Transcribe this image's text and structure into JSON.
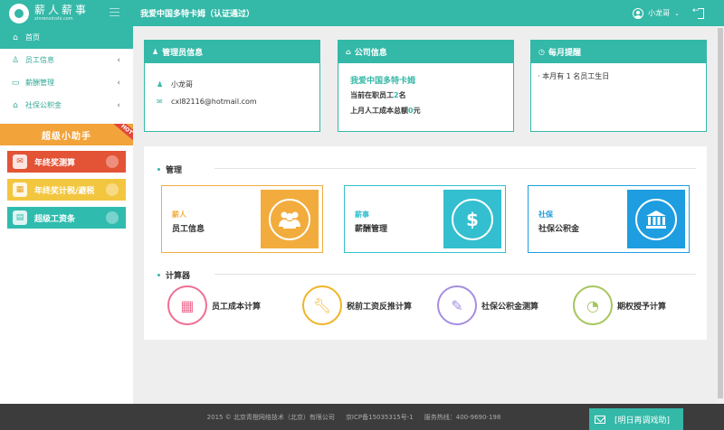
{
  "app": {
    "logo_cn": "薪人薪事",
    "logo_en": "xinrenxinshi.com",
    "company_title": "我爱中国多特卡姆（认证通过）",
    "user_name": "小龙哥",
    "user_caret": "⌄"
  },
  "sidebar": {
    "items": [
      {
        "label": "首页",
        "icon": "home-icon"
      },
      {
        "label": "员工信息",
        "icon": "person-icon",
        "chevron": "‹"
      },
      {
        "label": "薪酬管理",
        "icon": "folder-icon",
        "chevron": "‹"
      },
      {
        "label": "社保公积金",
        "icon": "bank-icon",
        "chevron": "‹"
      }
    ],
    "helper_title": "超级小助手",
    "hot_badge": "HOT",
    "promos": [
      {
        "label": "年终奖测算",
        "icon": "red-envelope-icon"
      },
      {
        "label": "年终奖计税/避税",
        "icon": "calculator-icon"
      },
      {
        "label": "超级工资条",
        "icon": "payslip-icon"
      }
    ]
  },
  "admin_card": {
    "title": "管理员信息",
    "name": "小龙哥",
    "email": "cxl82116@hotmail.com"
  },
  "company_card": {
    "title": "公司信息",
    "company_name": "我爱中国多特卡姆",
    "staff_prefix": "当前在职员工",
    "staff_count": "2",
    "staff_suffix": "名",
    "cost_prefix": "上月人工成本总额",
    "cost_value": "0",
    "cost_suffix": "元"
  },
  "reminder_card": {
    "title": "每月提醒",
    "text": "· 本月有 1 名员工生日"
  },
  "management": {
    "title": "管理",
    "cards": [
      {
        "tag": "薪人",
        "name": "员工信息",
        "color": "#f2ac3d",
        "icon": "people-icon"
      },
      {
        "tag": "薪事",
        "name": "薪酬管理",
        "color": "#33bfcf",
        "icon": "dollar-icon"
      },
      {
        "tag": "社保",
        "name": "社保公积金",
        "color": "#1e9de0",
        "icon": "bank-icon"
      }
    ]
  },
  "calculators": {
    "title": "计算器",
    "items": [
      {
        "label": "员工成本计算",
        "color": "#ef6e92",
        "icon": "calculator-icon"
      },
      {
        "label": "税前工资反推计算",
        "color": "#f0b428",
        "icon": "wrench-icon"
      },
      {
        "label": "社保公积金测算",
        "color": "#a58ee0",
        "icon": "edit-icon"
      },
      {
        "label": "期权授予计算",
        "color": "#a6c65e",
        "icon": "protractor-icon"
      }
    ]
  },
  "footer": {
    "copyright": "2015 © 北京青橙网络技术（北京）有限公司",
    "icp": "京ICP备15035315号-1",
    "phone": "服务热线：400-9690-198"
  },
  "remind_button": "[明日再调戏助]"
}
